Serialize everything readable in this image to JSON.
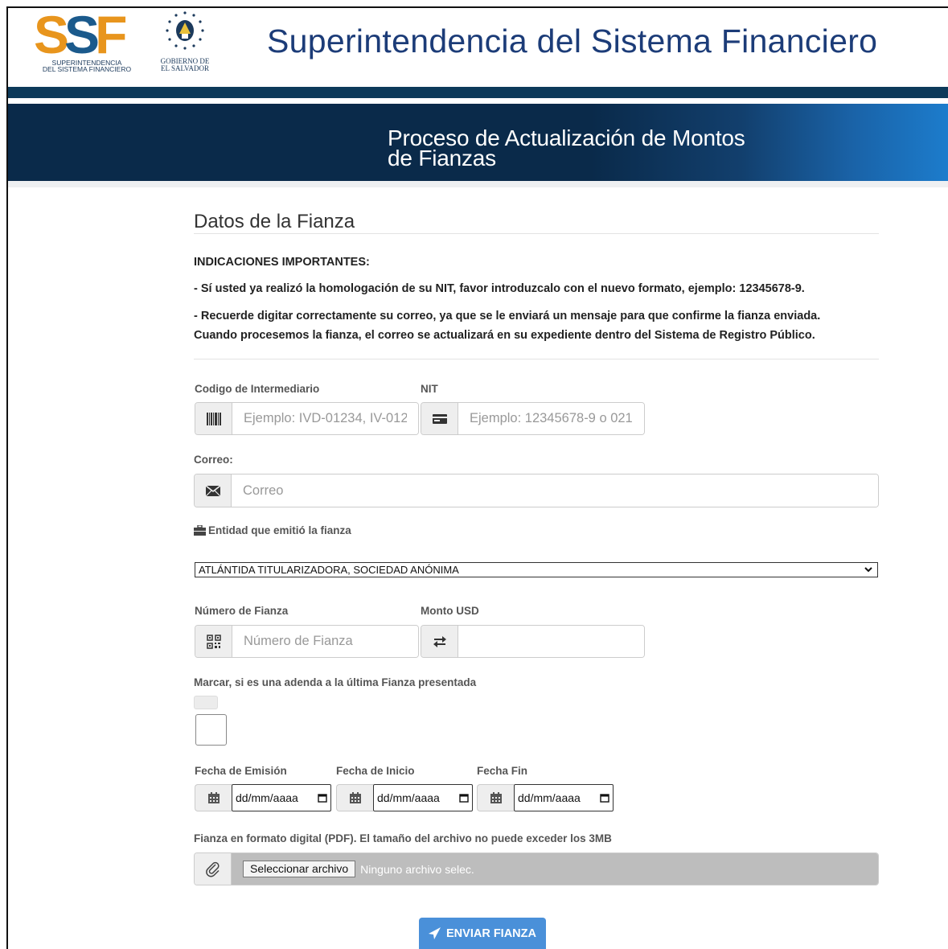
{
  "header": {
    "ssf_logo_text": "SSF",
    "ssf_logo_subtitle_line1": "SUPERINTENDENCIA",
    "ssf_logo_subtitle_line2": "DEL SISTEMA FINANCIERO",
    "gov_logo_line1": "GOBIERNO DE",
    "gov_logo_line2": "EL SALVADOR",
    "site_title": "Superintendencia del Sistema Financiero"
  },
  "hero": {
    "title_line1": "Proceso de Actualización de Montos",
    "title_line2": "de Fianzas"
  },
  "form": {
    "section_title": "Datos de la Fianza",
    "notes": {
      "heading": "INDICACIONES IMPORTANTES:",
      "line1": "- Sí usted ya realizó la homologación de su NIT, favor introduzcalo con el nuevo formato, ejemplo: 12345678-9.",
      "line2": "- Recuerde digitar correctamente su correo, ya que se le enviará un mensaje para que confirme la fianza enviada.",
      "line3": "Cuando procesemos la fianza, el correo se actualizará en su expediente dentro del Sistema de Registro Público."
    },
    "codigo": {
      "label": "Codigo de Intermediario",
      "placeholder": "Ejemplo: IVD-01234, IV-012",
      "value": "",
      "icon": "barcode-icon"
    },
    "nit": {
      "label": "NIT",
      "placeholder": "Ejemplo: 12345678-9 o 021",
      "value": "",
      "icon": "id-card-icon"
    },
    "correo": {
      "label": "Correo:",
      "placeholder": "Correo",
      "value": "",
      "icon": "envelope-icon"
    },
    "entidad": {
      "label": "Entidad que emitió la fianza",
      "selected": "ATLÁNTIDA TITULARIZADORA, SOCIEDAD ANÓNIMA",
      "icon": "briefcase-icon"
    },
    "numero_fianza": {
      "label": "Número de Fianza",
      "placeholder": "Número de Fianza",
      "value": "",
      "icon": "qrcode-icon"
    },
    "monto": {
      "label": "Monto USD",
      "placeholder": "",
      "value": "",
      "icon": "exchange-icon"
    },
    "adenda": {
      "label": "Marcar, si es una adenda a la última Fianza presentada",
      "checked": false
    },
    "fecha_emision": {
      "label": "Fecha de Emisión",
      "value": "dd/mm/aaaa"
    },
    "fecha_inicio": {
      "label": "Fecha de Inicio",
      "value": "dd/mm/aaaa"
    },
    "fecha_fin": {
      "label": "Fecha Fin",
      "value": "dd/mm/aaaa"
    },
    "archivo": {
      "label": "Fianza en formato digital (PDF). El tamaño del archivo no puede exceder los 3MB",
      "button": "Seleccionar archivo",
      "status": "Ninguno archivo selec."
    },
    "submit_label": "ENVIAR FIANZA"
  },
  "colors": {
    "brand_blue": "#1c3c78",
    "brand_orange": "#e8951d",
    "hero_dark": "#0a2a4a",
    "button_blue": "#4a90d9"
  }
}
